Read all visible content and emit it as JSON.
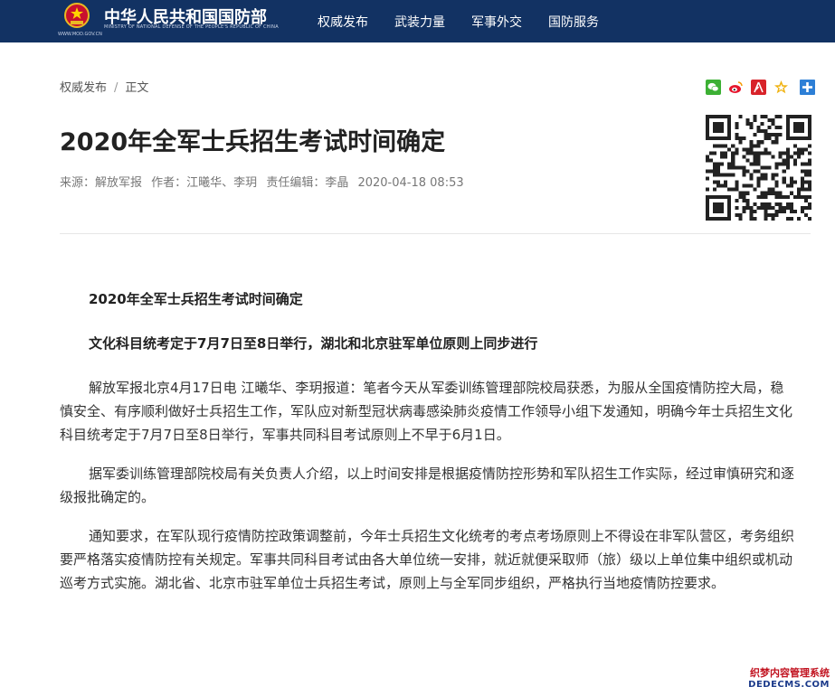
{
  "header": {
    "site_name": "中华人民共和国国防部",
    "site_sub": "MINISTRY OF NATIONAL DEFENSE OF THE PEOPLE'S REPUBLIC OF CHINA",
    "site_url": "WWW.MOD.GOV.CN",
    "nav": [
      "权威发布",
      "武装力量",
      "军事外交",
      "国防服务"
    ],
    "bg_color": "#123263"
  },
  "breadcrumb": {
    "section": "权威发布",
    "separator": "/",
    "current": "正文"
  },
  "share_icons": [
    "wechat-icon",
    "weibo-icon",
    "renren-icon",
    "favorite-star-icon",
    "more-plus-icon"
  ],
  "article": {
    "title": "2020年全军士兵招生考试时间确定",
    "meta": {
      "source": "来源：解放军报",
      "author": "作者：江曦华、李玥",
      "editor": "责任编辑：李晶",
      "datetime": "2020-04-18 08:53"
    },
    "paragraphs": [
      "2020年全军士兵招生考试时间确定",
      "文化科目统考定于7月7日至8日举行，湖北和北京驻军单位原则上同步进行",
      "解放军报北京4月17日电 江曦华、李玥报道：笔者今天从军委训练管理部院校局获悉，为服从全国疫情防控大局，稳慎安全、有序顺利做好士兵招生工作，军队应对新型冠状病毒感染肺炎疫情工作领导小组下发通知，明确今年士兵招生文化科目统考定于7月7日至8日举行，军事共同科目考试原则上不早于6月1日。",
      "据军委训练管理部院校局有关负责人介绍，以上时间安排是根据疫情防控形势和军队招生工作实际，经过审慎研究和逐级报批确定的。",
      "通知要求，在军队现行疫情防控政策调整前，今年士兵招生文化统考的考点考场原则上不得设在非军队营区，考务组织要严格落实疫情防控有关规定。军事共同科目考试由各大单位统一安排，就近就便采取师（旅）级以上单位集中组织或机动巡考方式实施。湖北省、北京市驻军单位士兵招生考试，原则上与全军同步组织，严格执行当地疫情防控要求。"
    ]
  },
  "watermark": {
    "line1": "织梦内容管理系统",
    "line2": "DEDECMS.COM"
  }
}
